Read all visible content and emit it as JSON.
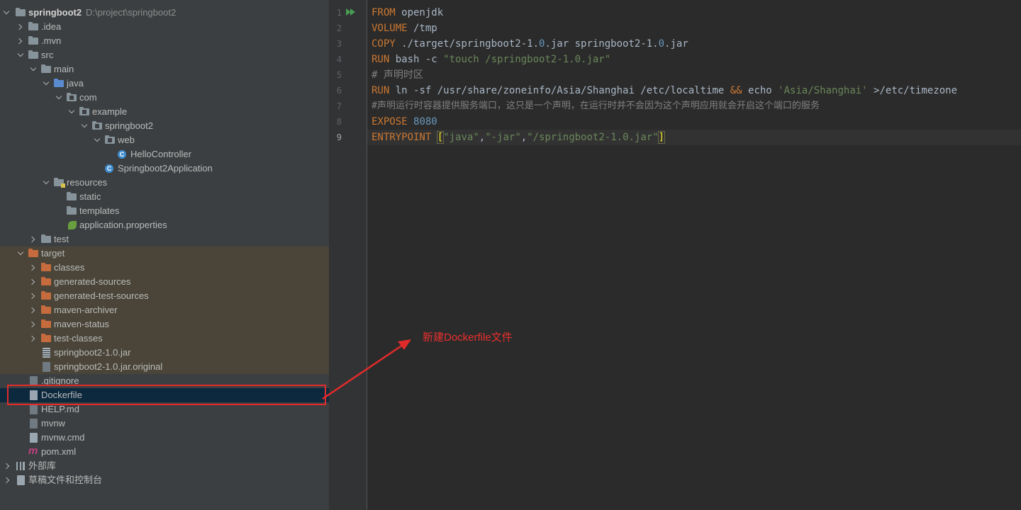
{
  "project_tree": {
    "root_name": "springboot2",
    "root_path": "D:\\project\\springboot2",
    "items": [
      {
        "label": ".idea"
      },
      {
        "label": ".mvn"
      },
      {
        "label": "src"
      },
      {
        "label": "main"
      },
      {
        "label": "java"
      },
      {
        "label": "com"
      },
      {
        "label": "example"
      },
      {
        "label": "springboot2"
      },
      {
        "label": "web"
      },
      {
        "label": "HelloController"
      },
      {
        "label": "Springboot2Application"
      },
      {
        "label": "resources"
      },
      {
        "label": "static"
      },
      {
        "label": "templates"
      },
      {
        "label": "application.properties"
      },
      {
        "label": "test"
      },
      {
        "label": "target"
      },
      {
        "label": "classes"
      },
      {
        "label": "generated-sources"
      },
      {
        "label": "generated-test-sources"
      },
      {
        "label": "maven-archiver"
      },
      {
        "label": "maven-status"
      },
      {
        "label": "test-classes"
      },
      {
        "label": "springboot2-1.0.jar"
      },
      {
        "label": "springboot2-1.0.jar.original"
      },
      {
        "label": ".gitignore"
      },
      {
        "label": "Dockerfile"
      },
      {
        "label": "HELP.md"
      },
      {
        "label": "mvnw"
      },
      {
        "label": "mvnw.cmd"
      },
      {
        "label": "pom.xml"
      },
      {
        "label": "外部库"
      },
      {
        "label": "草稿文件和控制台"
      }
    ]
  },
  "editor": {
    "line_numbers": [
      "1",
      "2",
      "3",
      "4",
      "5",
      "6",
      "7",
      "8",
      "9"
    ],
    "lines": [
      [
        "FROM",
        " openjdk"
      ],
      [
        "VOLUME",
        " /tmp"
      ],
      [
        "COPY",
        " ./target/springboot2-1.",
        "0",
        ".jar springboot2-1.",
        "0",
        ".jar"
      ],
      [
        "RUN",
        " bash -c ",
        "\"touch /springboot2-1.0.jar\""
      ],
      [
        "# 声明时区"
      ],
      [
        "RUN",
        " ln -sf /usr/share/zoneinfo/Asia/Shanghai /etc/localtime ",
        "&&",
        " echo ",
        "'Asia/Shanghai'",
        " >/etc/timezone"
      ],
      [
        "#声明运行时容器提供服务端口，这只是一个声明，在运行时并不会因为这个声明应用就会开启这个端口的服务"
      ],
      [
        "EXPOSE",
        " ",
        "8080"
      ],
      [
        "ENTRYPOINT",
        " ",
        "[",
        "\"java\"",
        ",",
        "\"-jar\"",
        ",",
        "\"/springboot2-1.0.jar\"",
        "]"
      ]
    ]
  },
  "annotation": {
    "text": "新建Dockerfile文件",
    "color": "#e12b2b"
  },
  "icons": {
    "run": "run-gutter-icon",
    "folder": "folder-icon",
    "file": "file-icon"
  }
}
